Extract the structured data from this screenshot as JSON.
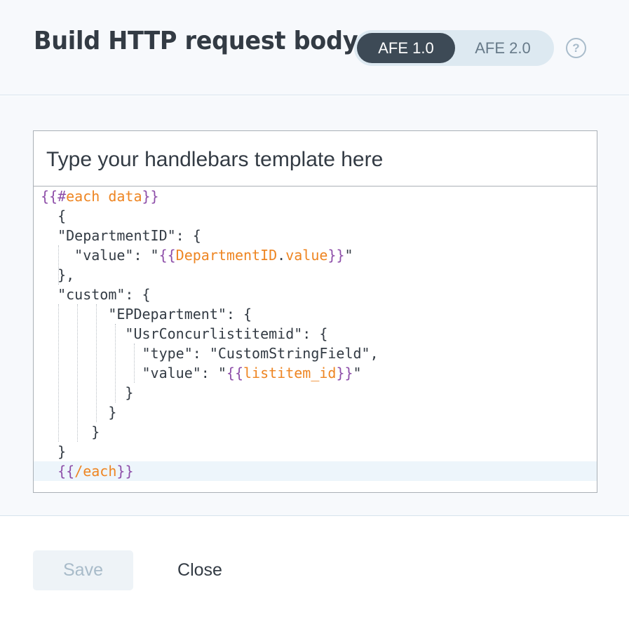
{
  "header": {
    "title": "Build HTTP request body",
    "toggle": {
      "option1": "AFE 1.0",
      "option2": "AFE 2.0",
      "selected": "AFE 1.0"
    },
    "help_icon": "?"
  },
  "editor": {
    "placeholder": "Type your handlebars template here",
    "code_lines": [
      "{{#each data}}",
      "  {",
      "  \"DepartmentID\": {",
      "    \"value\": \"{{DepartmentID.value}}\"",
      "  },",
      "  \"custom\": {",
      "        \"EPDepartment\": {",
      "          \"UsrConcurlistitemid\": {",
      "            \"type\": \"CustomStringField\",",
      "            \"value\": \"{{listitem_id}}\"",
      "          }",
      "        }",
      "      }",
      "  }",
      "  {{/each}}"
    ]
  },
  "footer": {
    "save_label": "Save",
    "close_label": "Close"
  },
  "colors": {
    "handlebars_brace": "#8e4fa9",
    "handlebars_expr": "#ee8522",
    "toggle_active_bg": "#3d4a56"
  }
}
